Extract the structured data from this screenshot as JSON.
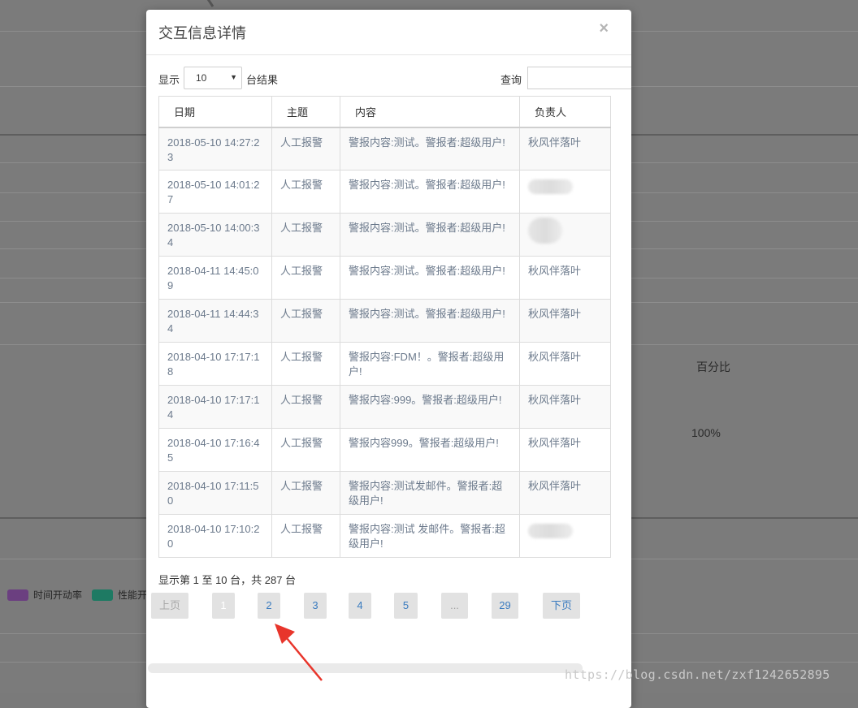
{
  "background": {
    "percent_label": "百分比",
    "percent_value": "100%",
    "legend": [
      {
        "label": "时间开动率",
        "color": "#6b3f80"
      },
      {
        "label": "性能开",
        "color": "#1e7a63"
      }
    ]
  },
  "modal": {
    "title": "交互信息详情",
    "close_symbol": "×",
    "length_prefix": "显示",
    "length_value": "10",
    "length_caret": "▼",
    "length_suffix": "台结果",
    "search_label": "查询",
    "columns": [
      "日期",
      "主题",
      "内容",
      "负责人"
    ],
    "rows": [
      {
        "date": "2018-05-10 14:27:23",
        "topic": "人工报警",
        "content": "警报内容:测试。警报者:超级用户!",
        "owner": "秋风伴落叶"
      },
      {
        "date": "2018-05-10 14:01:27",
        "topic": "人工报警",
        "content": "警报内容:测试。警报者:超级用户!",
        "owner": ""
      },
      {
        "date": "2018-05-10 14:00:34",
        "topic": "人工报警",
        "content": "警报内容:测试。警报者:超级用户!",
        "owner": ""
      },
      {
        "date": "2018-04-11 14:45:09",
        "topic": "人工报警",
        "content": "警报内容:测试。警报者:超级用户!",
        "owner": "秋风伴落叶"
      },
      {
        "date": "2018-04-11 14:44:34",
        "topic": "人工报警",
        "content": "警报内容:测试。警报者:超级用户!",
        "owner": "秋风伴落叶"
      },
      {
        "date": "2018-04-10 17:17:18",
        "topic": "人工报警",
        "content": "警报内容:FDM！。警报者:超级用户!",
        "owner": "秋风伴落叶"
      },
      {
        "date": "2018-04-10 17:17:14",
        "topic": "人工报警",
        "content": "警报内容:999。警报者:超级用户!",
        "owner": "秋风伴落叶"
      },
      {
        "date": "2018-04-10 17:16:45",
        "topic": "人工报警",
        "content": "警报内容999。警报者:超级用户!",
        "owner": "秋风伴落叶"
      },
      {
        "date": "2018-04-10 17:11:50",
        "topic": "人工报警",
        "content": "警报内容:测试发邮件。警报者:超级用户!",
        "owner": "秋风伴落叶"
      },
      {
        "date": "2018-04-10 17:10:20",
        "topic": "人工报警",
        "content": "警报内容:测试 发邮件。警报者:超级用户!",
        "owner": ""
      }
    ],
    "info": "显示第 1 至 10 台，共 287 台",
    "pagination": {
      "prev": "上页",
      "pages": [
        "1",
        "2",
        "3",
        "4",
        "5"
      ],
      "ellipsis": "...",
      "last": "29",
      "next": "下页",
      "current": "1"
    }
  },
  "watermark": "https://blog.csdn.net/zxf1242652895"
}
